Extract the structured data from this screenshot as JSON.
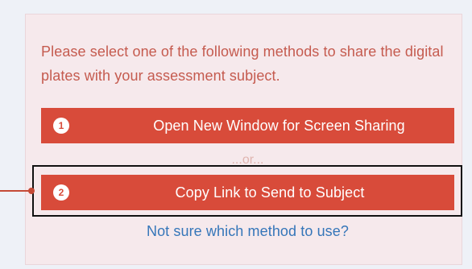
{
  "share_panel": {
    "instructions": "Please select one of the following methods to share the digital plates with your assessment subject.",
    "methods": [
      {
        "number": "1",
        "label": "Open New Window for Screen Sharing"
      },
      {
        "number": "2",
        "label": "Copy Link to Send to Subject"
      }
    ],
    "separator": "...or...",
    "help_link": "Not sure which method to use?"
  },
  "colors": {
    "panel_background": "#f6e9ec",
    "button_background": "#d84b3a",
    "instruction_text": "#c55b4f",
    "link_text": "#3576b9",
    "highlight_border": "#111111"
  }
}
